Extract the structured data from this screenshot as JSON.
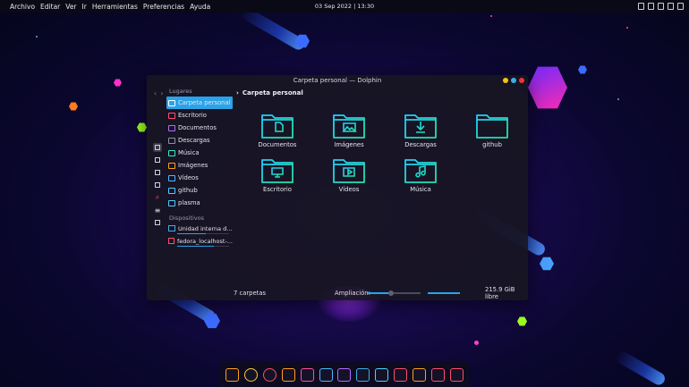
{
  "top_panel": {
    "menu": [
      "Archivo",
      "Editar",
      "Ver",
      "Ir",
      "Herramientas",
      "Preferencias",
      "Ayuda"
    ],
    "clock": "03 Sep 2022 | 13:30"
  },
  "window": {
    "title": "Carpeta personal — Dolphin",
    "buttons": [
      {
        "name": "minimize-button",
        "color": "#f5c211"
      },
      {
        "name": "maximize-button",
        "color": "#3daee9"
      },
      {
        "name": "close-button",
        "color": "#ed333b"
      }
    ]
  },
  "sidebar": {
    "places_title": "Lugares",
    "places": [
      {
        "label": "Carpeta personal",
        "icon": "home-folder-icon",
        "selected": true
      },
      {
        "label": "Escritorio",
        "icon": "desktop-icon"
      },
      {
        "label": "Documentos",
        "icon": "documents-icon"
      },
      {
        "label": "Descargas",
        "icon": "downloads-icon"
      },
      {
        "label": "Música",
        "icon": "music-icon"
      },
      {
        "label": "Imágenes",
        "icon": "pictures-icon"
      },
      {
        "label": "Vídeos",
        "icon": "videos-icon"
      },
      {
        "label": "github",
        "icon": "folder-icon"
      },
      {
        "label": "plasma",
        "icon": "folder-icon"
      }
    ],
    "devices_title": "Dispositivos",
    "devices": [
      {
        "label": "Unidad interna d...",
        "icon": "drive-icon",
        "usage": 0.55
      },
      {
        "label": "fedora_localhost-...",
        "icon": "drive-icon",
        "usage": 0.7
      }
    ]
  },
  "breadcrumb": "Carpeta personal",
  "files": [
    {
      "label": "Documentos",
      "icon": "document-folder-icon",
      "glyph": "doc"
    },
    {
      "label": "Imágenes",
      "icon": "pictures-folder-icon",
      "glyph": "img"
    },
    {
      "label": "Descargas",
      "icon": "downloads-folder-icon",
      "glyph": "down"
    },
    {
      "label": "github",
      "icon": "folder-icon",
      "glyph": ""
    },
    {
      "label": "Escritorio",
      "icon": "desktop-folder-icon",
      "glyph": "desk"
    },
    {
      "label": "Vídeos",
      "icon": "videos-folder-icon",
      "glyph": "vid"
    },
    {
      "label": "Música",
      "icon": "music-folder-icon",
      "glyph": "music"
    }
  ],
  "status": {
    "count": "7 carpetas",
    "zoom_label": "Ampliación:",
    "free": "215.9 GiB libre"
  },
  "dock": [
    {
      "name": "files-app-icon",
      "color": "#ff9f1c"
    },
    {
      "name": "chrome-app-icon",
      "color": "#ffc93c"
    },
    {
      "name": "firefox-app-icon",
      "color": "#ff4f6d"
    },
    {
      "name": "settings-app-icon",
      "color": "#ff9f1c"
    },
    {
      "name": "store-app-icon",
      "color": "#ff4fa0"
    },
    {
      "name": "writer-app-icon",
      "color": "#4fb5ff"
    },
    {
      "name": "image-viewer-app-icon",
      "color": "#b06bff"
    },
    {
      "name": "telegram-app-icon",
      "color": "#3daee9"
    },
    {
      "name": "terminal-app-icon",
      "color": "#4fd0ff"
    },
    {
      "name": "kdenlive-app-icon",
      "color": "#ff4f6d"
    },
    {
      "name": "photo-app-icon",
      "color": "#ff9f1c"
    },
    {
      "name": "git-app-icon",
      "color": "#ff4f6d"
    },
    {
      "name": "trash-app-icon",
      "color": "#ff4f6d"
    }
  ],
  "colors": {
    "accent": "#2aa3e8",
    "folder_gradient_start": "#1fd1ff",
    "folder_gradient_end": "#27e0a0"
  }
}
